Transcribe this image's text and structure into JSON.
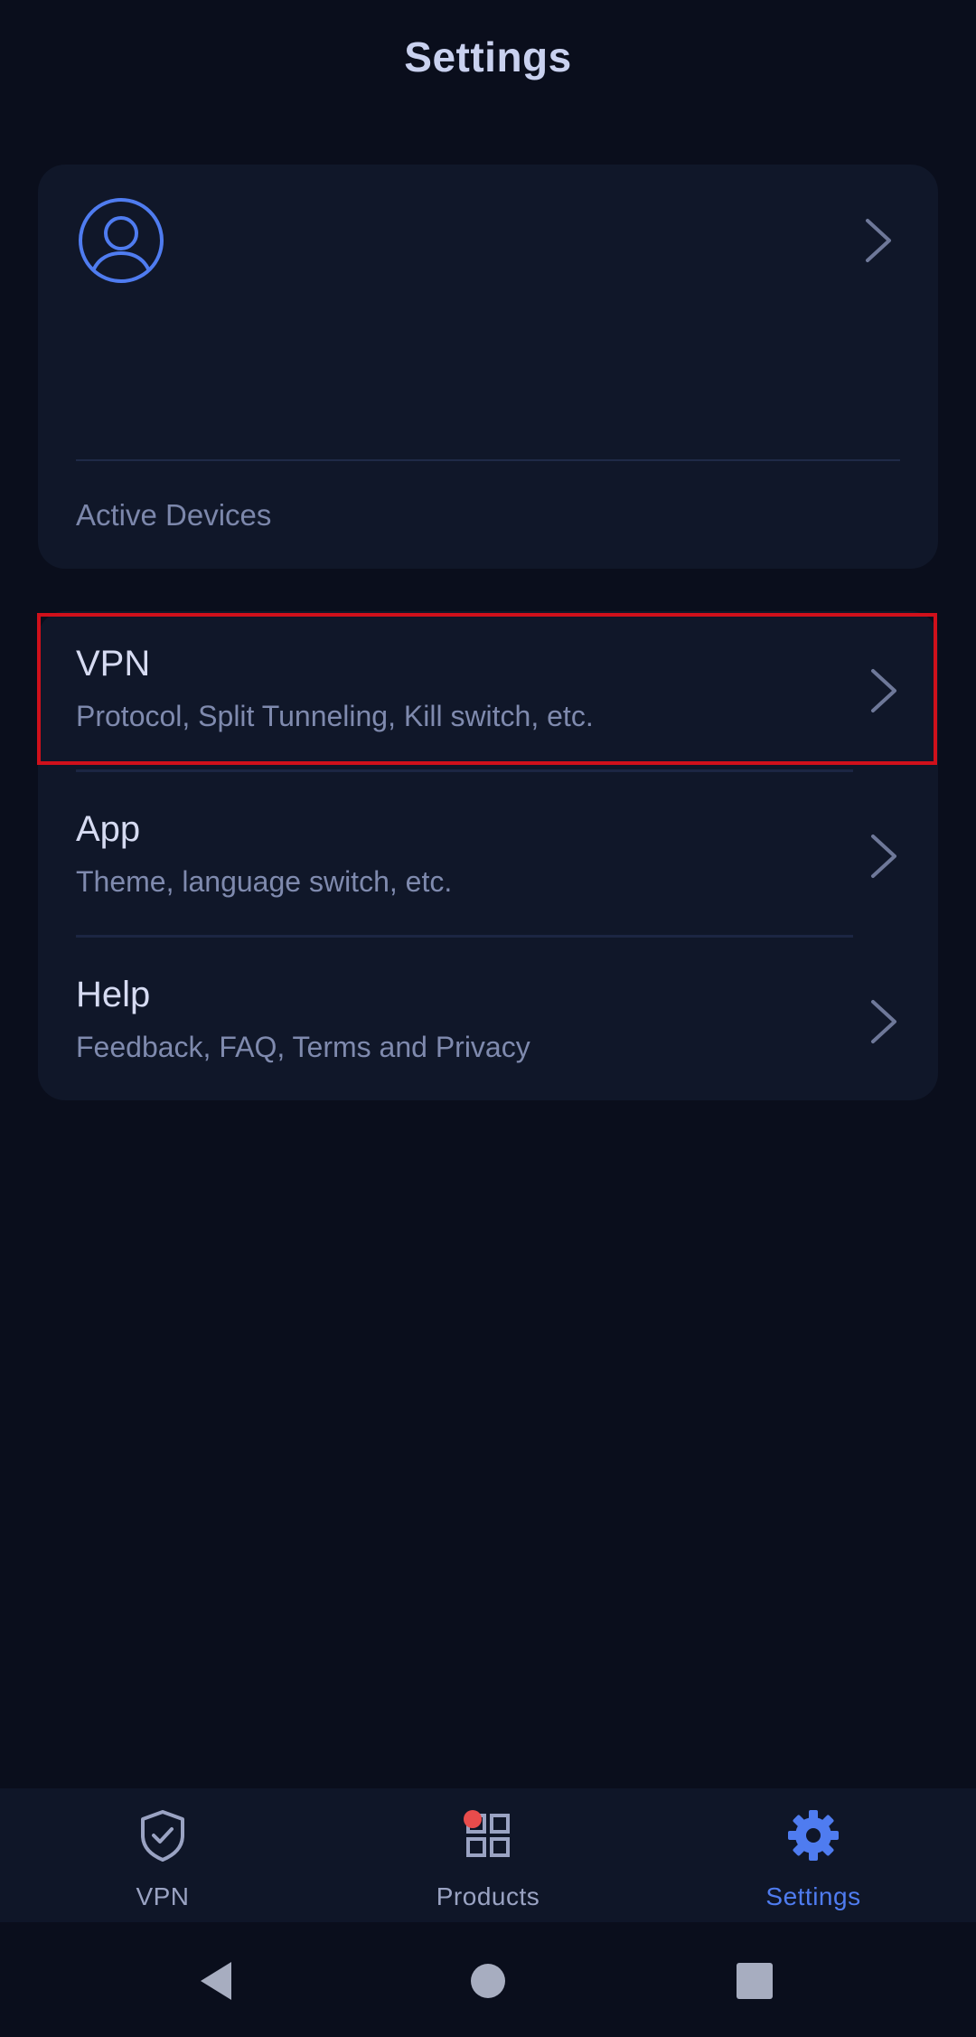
{
  "header": {
    "title": "Settings"
  },
  "account": {
    "active_devices_label": "Active Devices"
  },
  "settings_items": [
    {
      "title": "VPN",
      "subtitle": "Protocol, Split Tunneling, Kill switch, etc."
    },
    {
      "title": "App",
      "subtitle": "Theme, language switch, etc."
    },
    {
      "title": "Help",
      "subtitle": "Feedback, FAQ, Terms and Privacy"
    }
  ],
  "bottom_nav": {
    "items": [
      {
        "label": "VPN",
        "icon": "shield-check-icon",
        "active": false
      },
      {
        "label": "Products",
        "icon": "grid-icon",
        "active": false,
        "badge": true
      },
      {
        "label": "Settings",
        "icon": "gear-icon",
        "active": true
      }
    ]
  },
  "colors": {
    "background": "#0a0e1c",
    "card": "#101729",
    "accent": "#4f7cf0",
    "highlight": "#d0101b",
    "badge": "#e84c4c"
  }
}
